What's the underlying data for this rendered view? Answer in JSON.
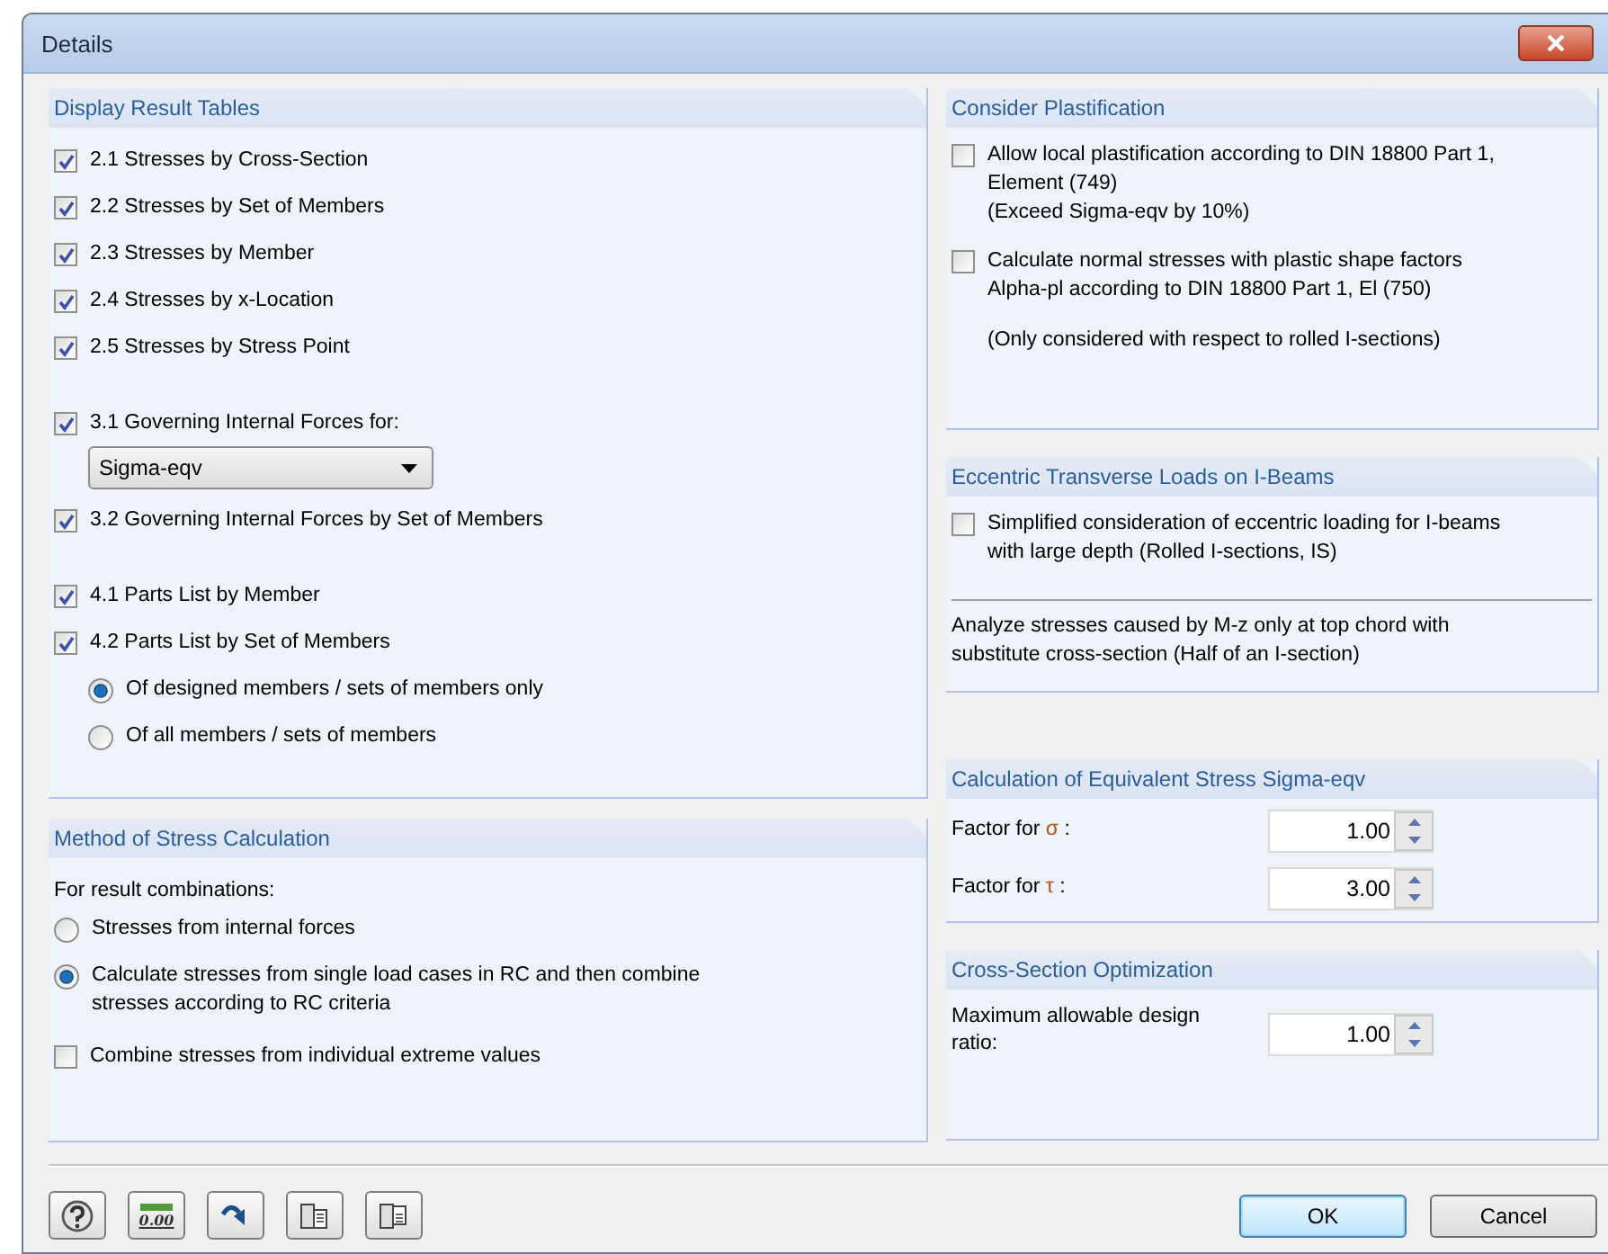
{
  "window": {
    "title": "Details"
  },
  "display_result_tables": {
    "title": "Display Result Tables",
    "groups": [
      [
        {
          "kind": "checkbox",
          "label": "2.1 Stresses by Cross-Section",
          "checked": true
        },
        {
          "kind": "checkbox",
          "label": "2.2 Stresses by Set of Members",
          "checked": true
        },
        {
          "kind": "checkbox",
          "label": "2.3 Stresses by Member",
          "checked": true
        },
        {
          "kind": "checkbox",
          "label": "2.4 Stresses by x-Location",
          "checked": true
        },
        {
          "kind": "checkbox",
          "label": "2.5 Stresses by Stress Point",
          "checked": true
        }
      ],
      [
        {
          "kind": "checkbox",
          "label": "3.1 Governing Internal Forces for:",
          "checked": true
        },
        {
          "kind": "dropdown",
          "value": "Sigma-eqv"
        },
        {
          "kind": "checkbox",
          "label": "3.2 Governing Internal Forces by Set of Members",
          "checked": true
        }
      ],
      [
        {
          "kind": "checkbox",
          "label": "4.1 Parts List by Member",
          "checked": true
        },
        {
          "kind": "checkbox",
          "label": "4.2 Parts List by Set of Members",
          "checked": true
        },
        {
          "kind": "radio",
          "label": "Of designed members / sets of members only",
          "selected": true
        },
        {
          "kind": "radio",
          "label": "Of all members / sets of members",
          "selected": false
        }
      ]
    ]
  },
  "method_of_stress_calculation": {
    "title": "Method of Stress Calculation",
    "intro": "For result combinations:",
    "options": [
      {
        "label": "Stresses from internal forces",
        "selected": false
      },
      {
        "label": "Calculate stresses from single load cases in RC and then combine\nstresses according to RC criteria",
        "selected": true
      }
    ],
    "extreme_values": {
      "label": "Combine stresses from individual extreme values",
      "checked": false
    }
  },
  "consider_plastification": {
    "title": "Consider Plastification",
    "options": [
      {
        "label": "Allow local plastification according to DIN 18800 Part 1,\nElement (749)\n(Exceed Sigma-eqv by 10%)",
        "checked": false
      },
      {
        "label": "Calculate normal stresses with plastic shape factors\nAlpha-pl according to DIN 18800 Part 1, El (750)",
        "checked": false
      }
    ],
    "note": "(Only considered with respect to rolled I-sections)"
  },
  "eccentric_transverse_loads": {
    "title": "Eccentric Transverse Loads on I-Beams",
    "option": {
      "label": "Simplified consideration of eccentric loading for I-beams\nwith large depth (Rolled I-sections, IS)",
      "checked": false
    },
    "note": "Analyze stresses caused by M-z only at top chord with\nsubstitute cross-section (Half of an I-section)"
  },
  "equivalent_stress": {
    "title": "Calculation of Equivalent Stress Sigma-eqv",
    "fields": [
      {
        "label": "Factor for",
        "symbol": "σ",
        "suffix": ":",
        "value": "1.00"
      },
      {
        "label": "Factor for",
        "symbol": "τ",
        "suffix": ":",
        "value": "3.00"
      }
    ]
  },
  "cross_section_optimization": {
    "title": "Cross-Section Optimization",
    "fields": [
      {
        "label": "Maximum allowable design\nratio:",
        "value": "1.00"
      }
    ]
  },
  "footer": {
    "tools": [
      {
        "kind": "help"
      },
      {
        "kind": "units",
        "text": "0.00"
      },
      {
        "kind": "arrow"
      },
      {
        "kind": "export"
      },
      {
        "kind": "import"
      }
    ],
    "buttons": [
      {
        "label": "OK",
        "default": true
      },
      {
        "label": "Cancel",
        "default": false
      }
    ]
  }
}
